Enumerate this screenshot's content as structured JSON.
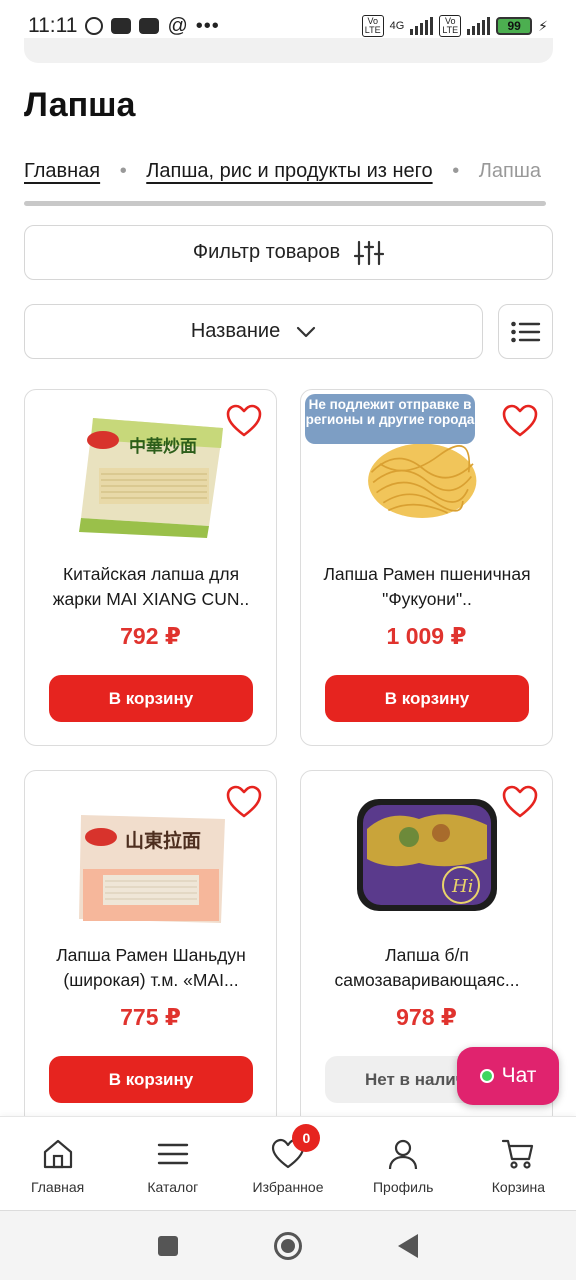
{
  "status_bar": {
    "time": "11:11",
    "network_type": "4G",
    "volte_label": "Vo LTE",
    "battery_level": "99",
    "icons": [
      "alarm-icon",
      "youtube-icon",
      "youtube-icon",
      "at-icon",
      "more-icon"
    ]
  },
  "page": {
    "title": "Лапша"
  },
  "breadcrumb": {
    "items": [
      "Главная",
      "Лапша, рис и продукты из него",
      "Лапша"
    ]
  },
  "filter": {
    "label": "Фильтр товаров"
  },
  "sort": {
    "selected": "Название"
  },
  "products": [
    {
      "name": "Китайская лапша для жарки MAI XIANG CUN..",
      "price": "792 ₽",
      "button_label": "В корзину",
      "badge": "",
      "image_caption": "中華炒面"
    },
    {
      "name": "Лапша Рамен пшеничная \"Фукуони\"..",
      "price": "1 009 ₽",
      "button_label": "В корзину",
      "badge": "Не подлежит отправке в регионы и другие города",
      "image_caption": ""
    },
    {
      "name": "Лапша Рамен Шаньдун (широкая) т.м. «MAI...",
      "price": "775 ₽",
      "button_label": "В корзину",
      "badge": "",
      "image_caption": "山東拉面"
    },
    {
      "name": "Лапша б/п самозаваривающаяс...",
      "price": "978 ₽",
      "button_label": "Нет в наличии",
      "badge": "",
      "image_caption": "Hi"
    }
  ],
  "chat": {
    "label": "Чат"
  },
  "bottom_nav": {
    "items": [
      {
        "label": "Главная",
        "icon": "home-icon"
      },
      {
        "label": "Каталог",
        "icon": "menu-icon"
      },
      {
        "label": "Избранное",
        "icon": "heart-icon"
      },
      {
        "label": "Профиль",
        "icon": "user-icon"
      },
      {
        "label": "Корзина",
        "icon": "cart-icon"
      }
    ],
    "favorites_count": "0"
  },
  "colors": {
    "accent_red": "#e6241f",
    "price_red": "#e0332e",
    "badge_blue": "#7d9ec4",
    "chat_pink": "#e0236e"
  }
}
